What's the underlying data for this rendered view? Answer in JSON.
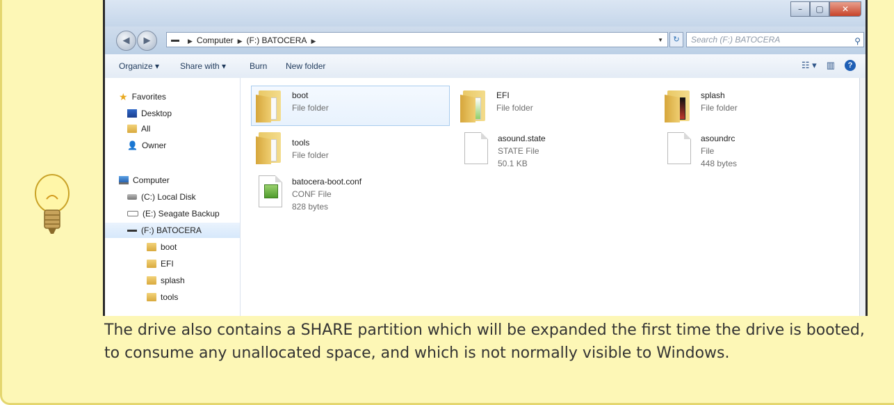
{
  "window": {
    "min_glyph": "–",
    "max_glyph": "▢",
    "close_glyph": "✕"
  },
  "address": {
    "crumbs": [
      "Computer",
      "(F:) BATOCERA"
    ],
    "search_placeholder": "Search (F:) BATOCERA"
  },
  "toolbar": {
    "organize": "Organize ▾",
    "share_with": "Share with ▾",
    "burn": "Burn",
    "new_folder": "New folder"
  },
  "nav": {
    "favorites": "Favorites",
    "desktop": "Desktop",
    "all": "All",
    "owner": "Owner",
    "computer": "Computer",
    "c_drive": "(C:) Local Disk",
    "e_drive": "(E:) Seagate Backup",
    "f_drive": "(F:) BATOCERA",
    "sub": [
      "boot",
      "EFI",
      "splash",
      "tools"
    ]
  },
  "files": [
    {
      "name": "boot",
      "type": "File folder",
      "size": ""
    },
    {
      "name": "EFI",
      "type": "File folder",
      "size": ""
    },
    {
      "name": "splash",
      "type": "File folder",
      "size": ""
    },
    {
      "name": "tools",
      "type": "File folder",
      "size": ""
    },
    {
      "name": "asound.state",
      "type": "STATE File",
      "size": "50.1 KB"
    },
    {
      "name": "asoundrc",
      "type": "File",
      "size": "448 bytes"
    },
    {
      "name": "batocera-boot.conf",
      "type": "CONF File",
      "size": "828 bytes"
    }
  ],
  "caption": "The drive also contains a SHARE partition which will be expanded the first time the drive is booted, to consume any unallocated space, and which is not normally visible to Windows.",
  "colors": {
    "tip_background": "#fdf7b6",
    "tip_border": "#e4d66f"
  }
}
